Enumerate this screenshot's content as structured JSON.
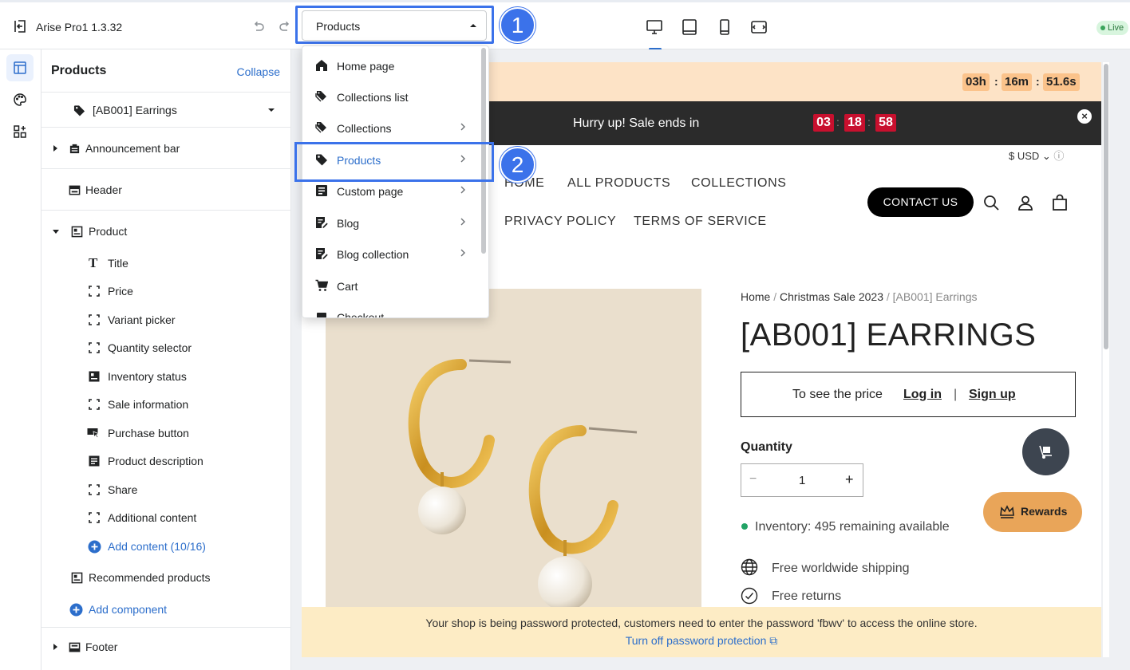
{
  "topbar": {
    "app_title": "Arise Pro1  1.3.32",
    "page_select_value": "Products",
    "live_badge": "Live",
    "callout_1": "1",
    "callout_2": "2"
  },
  "sidebar": {
    "title": "Products",
    "collapse_label": "Collapse",
    "product_picker": "[AB001] Earrings",
    "sections": {
      "announcement": "Announcement bar",
      "header": "Header",
      "product": "Product",
      "product_blocks": [
        "Title",
        "Price",
        "Variant picker",
        "Quantity selector",
        "Inventory status",
        "Sale information",
        "Purchase button",
        "Product description",
        "Share",
        "Additional content"
      ],
      "add_content": "Add content (10/16)",
      "recommended": "Recommended products",
      "add_component": "Add component",
      "footer": "Footer"
    }
  },
  "dropdown": {
    "items": [
      {
        "label": "Home page",
        "icon": "home-icon",
        "has_submenu": false
      },
      {
        "label": "Collections list",
        "icon": "tags-icon",
        "has_submenu": false
      },
      {
        "label": "Collections",
        "icon": "tags-icon",
        "has_submenu": true
      },
      {
        "label": "Products",
        "icon": "tag-icon",
        "has_submenu": true,
        "selected": true
      },
      {
        "label": "Custom page",
        "icon": "page-icon",
        "has_submenu": true
      },
      {
        "label": "Blog",
        "icon": "blog-icon",
        "has_submenu": true
      },
      {
        "label": "Blog collection",
        "icon": "blog-icon",
        "has_submenu": true
      },
      {
        "label": "Cart",
        "icon": "cart-icon",
        "has_submenu": false
      },
      {
        "label": "Checkout",
        "icon": "checkout-icon",
        "has_submenu": false
      }
    ]
  },
  "preview": {
    "countdown_top": {
      "hours": "03h",
      "minutes": "16m",
      "seconds": "51.6s",
      "sep": ":"
    },
    "sale_bar": {
      "text": "Hurry up! Sale ends in",
      "h": "03",
      "m": "18",
      "s": "58",
      "sep": ":"
    },
    "currency": "$ USD",
    "nav": [
      "HOME",
      "ALL PRODUCTS",
      "COLLECTIONS",
      "PRIVACY POLICY",
      "TERMS OF SERVICE"
    ],
    "contact_us": "CONTACT US",
    "breadcrumb": {
      "home": "Home",
      "collection": "Christmas Sale 2023",
      "current": "[AB001] Earrings",
      "sep": "/"
    },
    "product_title": "[AB001] EARRINGS",
    "price_box": {
      "text": "To see the price",
      "login": "Log in",
      "divider": "|",
      "signup": "Sign up"
    },
    "quantity_label": "Quantity",
    "quantity": {
      "minus": "−",
      "value": "1",
      "plus": "+"
    },
    "inventory": "Inventory: 495 remaining available",
    "features": [
      "Free worldwide shipping",
      "Free returns"
    ],
    "rewards": "Rewards",
    "password_bar": {
      "text": "Your shop is being password protected, customers need to enter the password 'fbwv' to access the online store.",
      "link": "Turn off password protection"
    }
  },
  "colors": {
    "accent": "#3b72ea",
    "link": "#2c6ecb",
    "sale_red": "#c8102e",
    "rewards": "#e9a559"
  }
}
